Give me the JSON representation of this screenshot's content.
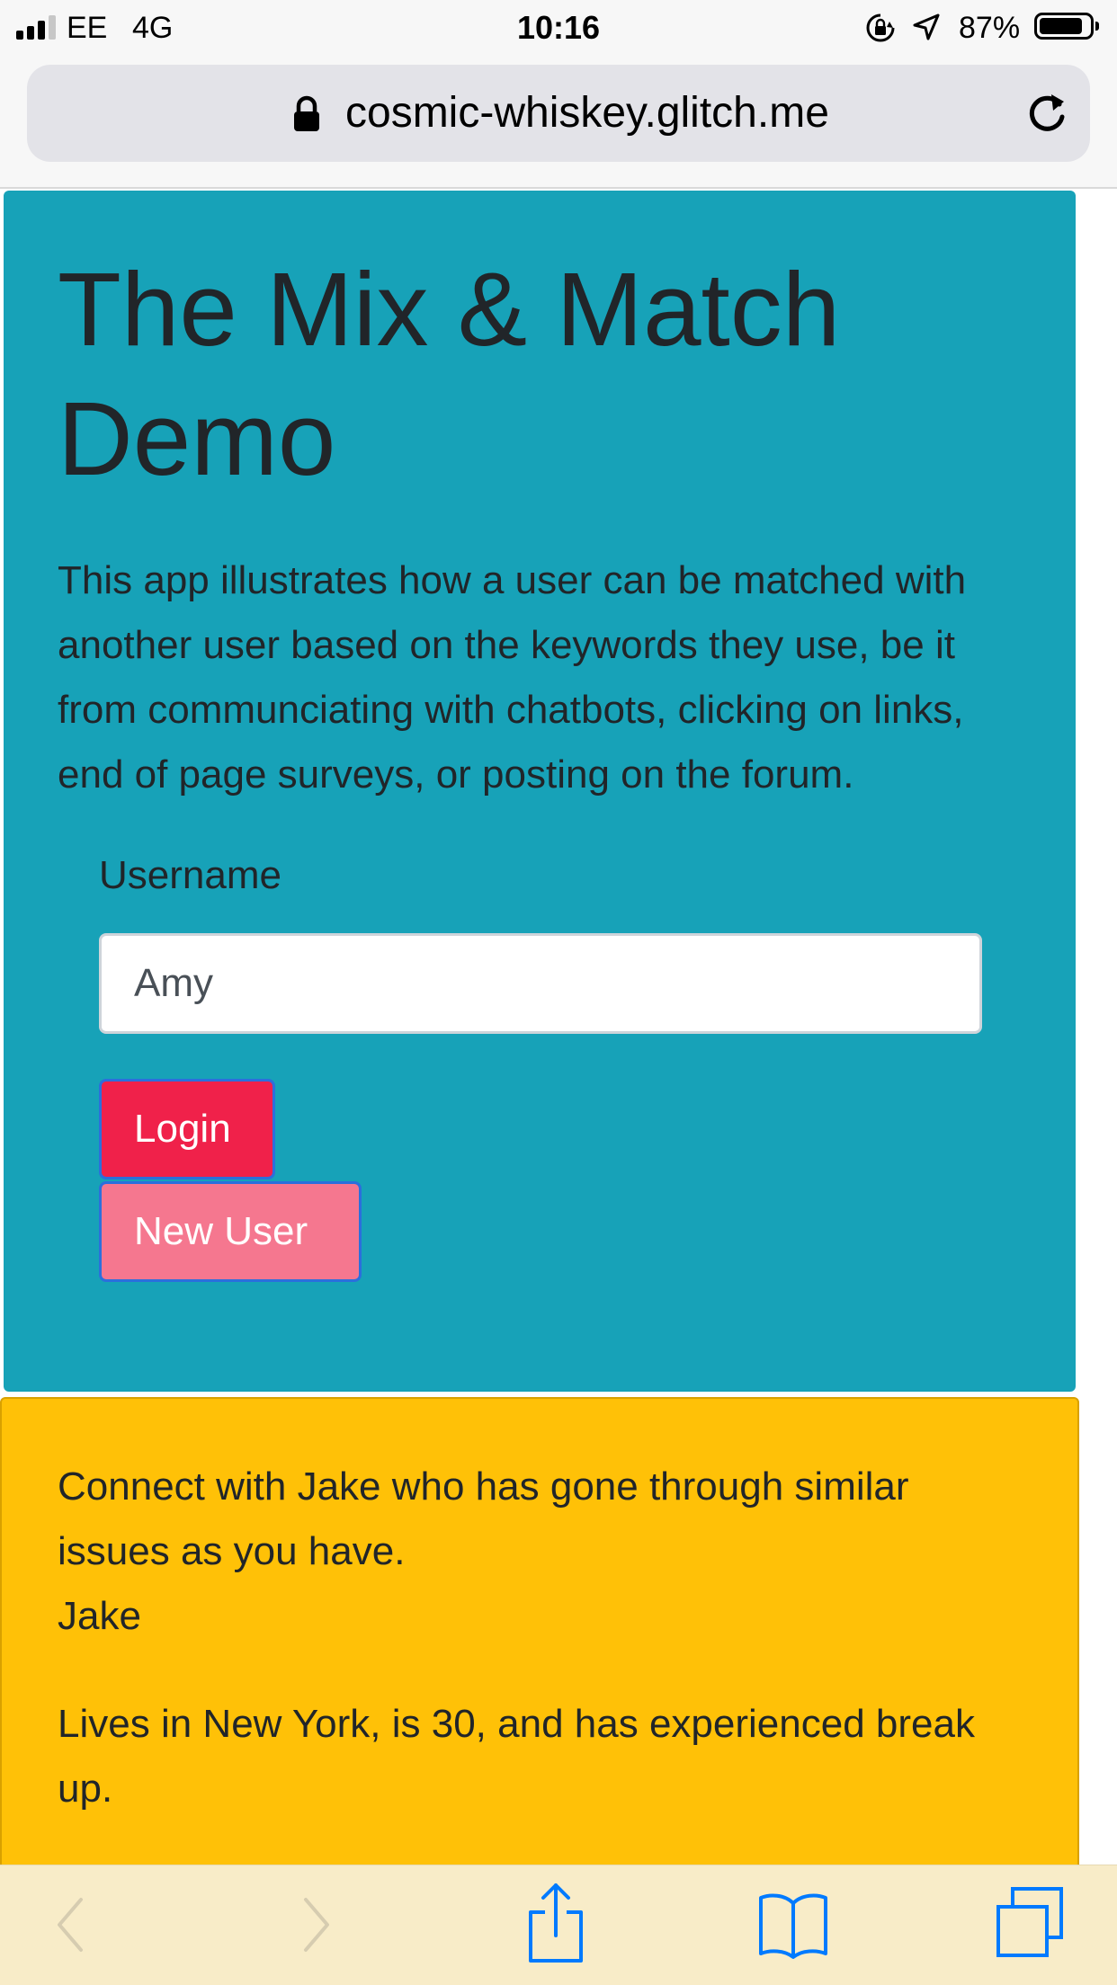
{
  "status_bar": {
    "carrier": "EE",
    "network": "4G",
    "time": "10:16",
    "battery_percent": "87%",
    "battery_level": 0.87,
    "signal_bars": 3
  },
  "browser": {
    "url": "cosmic-whiskey.glitch.me"
  },
  "jumbotron": {
    "title": "The Mix & Match Demo",
    "description": "This app illustrates how a user can be matched with another user based on the keywords they use, be it from communciating with chatbots, clicking on links, end of page surveys, or posting on the forum.",
    "username_label": "Username",
    "username_value": "Amy",
    "login_label": "Login",
    "new_user_label": "New User"
  },
  "match": {
    "intro": "Connect with Jake who has gone through similar issues as you have.",
    "name": "Jake",
    "details": "Lives in New York, is 30, and has experienced break up."
  },
  "colors": {
    "jumbotron_bg": "#17a2b8",
    "match_bg": "#ffc107",
    "login_bg": "#f0214a",
    "new_user_bg": "#f5778f",
    "toolbar_tint": "#007aff"
  },
  "toolbar": {
    "icons": [
      "back-icon",
      "forward-icon",
      "share-icon",
      "bookmarks-icon",
      "tabs-icon"
    ]
  }
}
